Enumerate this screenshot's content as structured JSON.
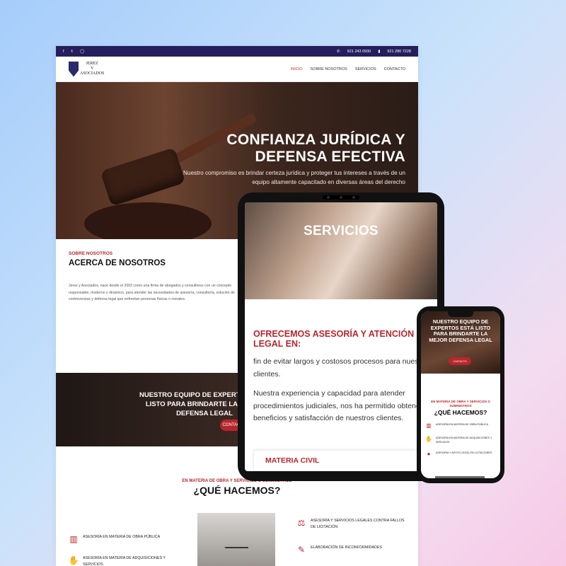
{
  "desktop": {
    "topbar": {
      "social": [
        "f",
        "𝕥",
        "◯"
      ],
      "phone1": "921 243 0930",
      "phone2": "921 280 7228"
    },
    "logo": {
      "line1": "JEREZ",
      "line2": "Y",
      "line3": "ASOCIADOS"
    },
    "menu": [
      "INICIO",
      "SOBRE NOSOTROS",
      "SERVICIOS",
      "CONTACTO"
    ],
    "hero": {
      "title": "CONFIANZA JURÍDICA Y DEFENSA EFECTIVA",
      "subtitle": "Nuestro compromiso es brindar certeza jurídica y proteger tus intereses a través de un equipo altamente capacitado en diversas áreas del derecho"
    },
    "about": {
      "kicker": "SOBRE NOSOTROS",
      "title": "ACERCA DE NOSOTROS",
      "body": "Jerez y Asociados, nace desde el 2003 como una firma de abogados y consultores con un concepto responsable, moderno y dinámico, para atender las necesidades de asesoría, consultoría, solución de controversias y defensa legal que enfrentan personas físicas o morales."
    },
    "band": {
      "title": "NUESTRO EQUIPO DE EXPERTOS ESTÁ LISTO PARA BRINDARTE LA MEJOR DEFENSA LEGAL",
      "button": "CONTACTO"
    },
    "what": {
      "kicker": "EN MATERIA DE OBRA Y SERVICIOS O SUMINISTROS",
      "title": "¿QUÉ HACEMOS?",
      "items": [
        "ASESORÍA EN MATERIA DE OBRA PÚBLICA",
        "ASESORÍA EN MATERIA DE ADQUISICIONES Y SERVICIOS",
        "ASESORÍA Y SERVICIOS LEGALES CONTRA FALLOS DE LICITACIÓN",
        "ELABORACIÓN DE INCONFORMIDADES"
      ]
    }
  },
  "tablet": {
    "hero_title": "SERVICIOS",
    "heading": "OFRECEMOS ASESORÍA Y ATENCIÓN LEGAL EN:",
    "para1": "fin de evitar largos y costosos procesos para nuestros clientes.",
    "para2": "Nuestra experiencia y capacidad para atender procedimientos judiciales, nos ha permitido obtener beneficios y satisfacción de nuestros clientes.",
    "card": "MATERIA CIVIL"
  },
  "phone": {
    "hero_title": "NUESTRO EQUIPO DE EXPERTOS ESTÁ LISTO PARA BRINDARTE LA MEJOR DEFENSA LEGAL",
    "button": "CONTACTO",
    "kicker": "EN MATERIA DE OBRA Y SERVICIOS O SUMINISTROS",
    "title": "¿QUÉ HACEMOS?",
    "items": [
      "ASESORÍA EN MATERIA DE OBRA PÚBLICA",
      "ASESORÍA EN MATERIA DE ADQUISICIONES Y SERVICIOS",
      "ASESORÍA Y APOYO LEGAL EN LICITACIONES"
    ]
  },
  "colors": {
    "accent": "#b8262c",
    "topbar": "#241f5c"
  }
}
